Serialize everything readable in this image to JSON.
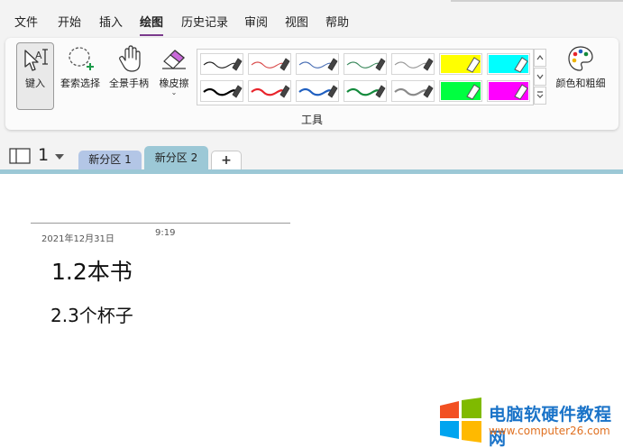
{
  "menu": {
    "items": [
      {
        "label": "文件",
        "active": false
      },
      {
        "label": "开始",
        "active": false
      },
      {
        "label": "插入",
        "active": false
      },
      {
        "label": "绘图",
        "active": true
      },
      {
        "label": "历史记录",
        "active": false
      },
      {
        "label": "审阅",
        "active": false
      },
      {
        "label": "视图",
        "active": false
      },
      {
        "label": "帮助",
        "active": false
      }
    ]
  },
  "ribbon": {
    "tools": {
      "type_label": "键入",
      "lasso_label": "套索选择",
      "pan_label": "全景手柄",
      "eraser_label": "橡皮擦",
      "color_thickness_label": "颜色和粗细"
    },
    "group_label": "工具",
    "pens": [
      {
        "color": "#222222",
        "kind": "pen"
      },
      {
        "color": "#d94c4c",
        "kind": "pen"
      },
      {
        "color": "#4a6fb5",
        "kind": "pen"
      },
      {
        "color": "#3d8a5e",
        "kind": "pen"
      },
      {
        "color": "#9a9a9a",
        "kind": "pen"
      },
      {
        "color": "#ffff00",
        "kind": "highlighter"
      },
      {
        "color": "#00ffff",
        "kind": "highlighter"
      },
      {
        "color": "#000000",
        "kind": "pen"
      },
      {
        "color": "#e8242b",
        "kind": "pen"
      },
      {
        "color": "#1f5fc0",
        "kind": "pen"
      },
      {
        "color": "#138a3c",
        "kind": "pen"
      },
      {
        "color": "#8a8a8a",
        "kind": "pen"
      },
      {
        "color": "#00ff40",
        "kind": "highlighter"
      },
      {
        "color": "#ff00ff",
        "kind": "highlighter"
      }
    ]
  },
  "sections": {
    "page_number": "1",
    "tabs": [
      {
        "label": "新分区 1",
        "color": "#b3c6e6",
        "active": false
      },
      {
        "label": "新分区 2",
        "color": "#9cc8d6",
        "active": true
      }
    ],
    "add_label": "+"
  },
  "page": {
    "date": "2021年12月31日",
    "time": "9:19",
    "line1": "1.2本书",
    "line2": "2.3个杯子"
  },
  "watermark": {
    "title": "电脑软硬件教程网",
    "url": "www.computer26.com"
  }
}
